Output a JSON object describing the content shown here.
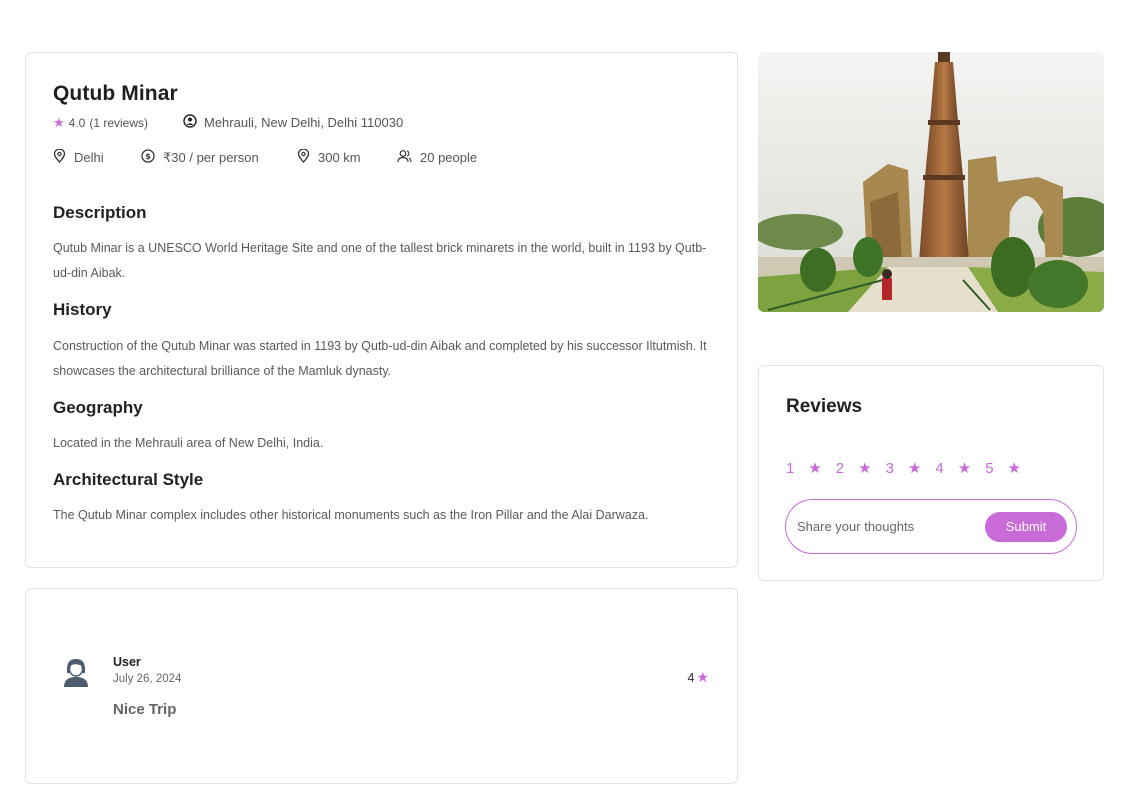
{
  "place": {
    "title": "Qutub Minar",
    "rating": "4.0",
    "reviews_count": "(1 reviews)",
    "address": "Mehrauli, New Delhi, Delhi 110030",
    "city": "Delhi",
    "price": "₹30 / per person",
    "distance": "300 km",
    "group_size": "20 people"
  },
  "sections": [
    {
      "heading": "Description",
      "text": "Qutub Minar is a UNESCO World Heritage Site and one of the tallest brick minarets in the world, built in 1193 by Qutb-ud-din Aibak."
    },
    {
      "heading": "History",
      "text": "Construction of the Qutub Minar was started in 1193 by Qutb-ud-din Aibak and completed by his successor Iltutmish. It showcases the architectural brilliance of the Mamluk dynasty."
    },
    {
      "heading": "Geography",
      "text": "Located in the Mehrauli area of New Delhi, India."
    },
    {
      "heading": "Architectural Style",
      "text": "The Qutub Minar complex includes other historical monuments such as the Iron Pillar and the Alai Darwaza."
    }
  ],
  "reviews_panel": {
    "title": "Reviews",
    "star_options": [
      "1",
      "2",
      "3",
      "4",
      "5"
    ],
    "input_placeholder": "Share your thoughts",
    "submit_label": "Submit"
  },
  "user_review": {
    "name": "User",
    "date": "July 26, 2024",
    "rating": "4",
    "comment": "Nice Trip"
  },
  "colors": {
    "accent": "#c86bd9",
    "border": "#e4e4e4",
    "text_muted": "#5a5a5a"
  },
  "icons": {
    "star": "star-icon",
    "address": "location-person-icon",
    "city": "map-pin-icon",
    "price": "currency-circle-icon",
    "distance": "map-pin-icon",
    "group": "users-icon",
    "avatar": "user-avatar-icon"
  }
}
